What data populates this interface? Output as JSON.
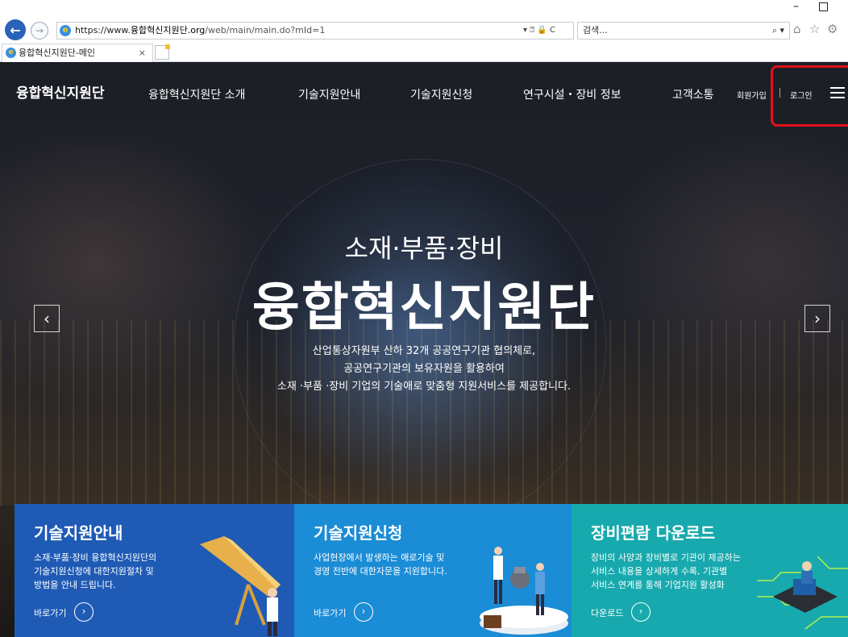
{
  "browser": {
    "url_prefix": "https://www.",
    "url_domain": "융합혁신지원단.org",
    "url_path": "/web/main/main.do?mId=1",
    "url_tools": "▾ ⍰ 🔒 C",
    "search_placeholder": "검색...",
    "search_icon": "⌕ ▾",
    "tab_title": "융합혁신지원단-메인",
    "tab_close": "×",
    "win_min": "–"
  },
  "site": {
    "logo": "융합혁신지원단",
    "nav": [
      "융합혁신지원단 소개",
      "기술지원안내",
      "기술지원신청",
      "연구시설・장비 정보",
      "고객소통"
    ],
    "signup": "회원가입",
    "login": "로그인"
  },
  "hero": {
    "subtitle": "소재·부품·장비",
    "title": "융합혁신지원단",
    "desc_line1": "산업통상자원부 산하 32개 공공연구기관 협의체로,",
    "desc_line2": "공공연구기관의 보유자원을 활용하여",
    "desc_line3": "소재 ·부품 ·장비 기업의 기술애로 맞춤형 지원서비스를 제공합니다.",
    "prev": "‹",
    "next": "›"
  },
  "cards": [
    {
      "title": "기술지원안내",
      "desc1": "소재·부품·장비 융합혁신지원단의",
      "desc2": "기술지원신청에 대한지원절차 및",
      "desc3": "방법을 안내 드립니다.",
      "link": "바로가기",
      "color": "#1f5bb5"
    },
    {
      "title": "기술지원신청",
      "desc1": "사업현장에서 발생하는 애로기술 및",
      "desc2": "경영 전반에 대한자문을 지원합니다.",
      "desc3": "",
      "link": "바로가기",
      "color": "#1b8cd6"
    },
    {
      "title": "장비편람 다운로드",
      "desc1": "장비의 사양과 장비별로 기관이 제공하는",
      "desc2": "서비스 내용을 상세하게 수록, 기관별",
      "desc3": "서비스 연계를 통해 기업지원 활성화",
      "link": "다운로드",
      "color": "#17a9ad"
    }
  ],
  "icons": {
    "link_arrow": "›"
  }
}
